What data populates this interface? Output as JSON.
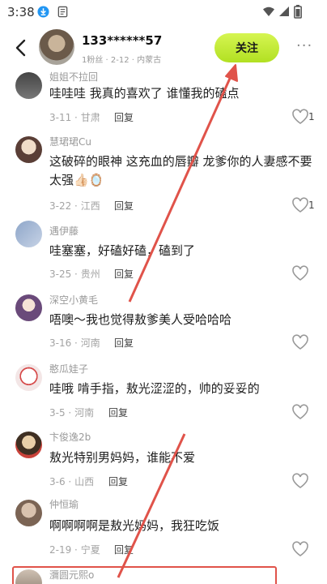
{
  "status_bar": {
    "time": "3:38"
  },
  "header": {
    "username": "133******57",
    "meta": "1粉丝 · 2-12 · 内蒙古",
    "follow_label": "关注",
    "more_label": "···"
  },
  "colors": {
    "follow_button": "#c6ee3a",
    "annotation_red": "#e0534a",
    "meta_gray": "#a3a3a3"
  },
  "comments": [
    {
      "name": "姐姐不拉回",
      "text": "哇哇哇 我真的喜欢了 谁懂我的磕点",
      "date": "3-11",
      "location": "甘肃",
      "reply": "回复",
      "likes": "1"
    },
    {
      "name": "慧珺珺Cu",
      "text": "这破碎的眼神 这充血的唇瓣 龙爹你的人妻感不要太强👍🏻🪞",
      "date": "3-22",
      "location": "江西",
      "reply": "回复",
      "likes": "1"
    },
    {
      "name": "遇伊藤",
      "text": "哇塞塞，好磕好磕，磕到了",
      "date": "3-25",
      "location": "贵州",
      "reply": "回复",
      "likes": ""
    },
    {
      "name": "深空小黄毛",
      "text": "唔噢～我也觉得敖爹美人受哈哈哈",
      "date": "3-16",
      "location": "河南",
      "reply": "回复",
      "likes": ""
    },
    {
      "name": "憨瓜娃子",
      "text": "哇哦 啃手指，敖光涩涩的，帅的妥妥的",
      "date": "3-5",
      "location": "河南",
      "reply": "回复",
      "likes": ""
    },
    {
      "name": "卞俊逸2b",
      "text": "敖光特别男妈妈，谁能不爱",
      "date": "3-6",
      "location": "山西",
      "reply": "回复",
      "likes": ""
    },
    {
      "name": "仲恒瑜",
      "text": "啊啊啊啊是敖光妈妈，我狂吃饭",
      "date": "2-19",
      "location": "宁夏",
      "reply": "回复",
      "likes": ""
    },
    {
      "name": "瀰圆元熙o",
      "text": "",
      "date": "",
      "location": "",
      "reply": "",
      "likes": ""
    }
  ]
}
